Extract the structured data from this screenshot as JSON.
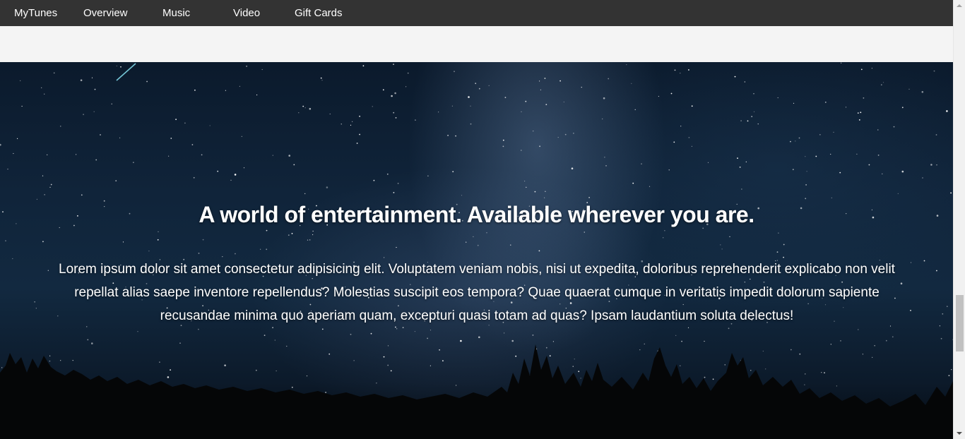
{
  "nav": {
    "brand": "MyTunes",
    "items": [
      {
        "label": "Overview"
      },
      {
        "label": "Music"
      },
      {
        "label": "Video"
      },
      {
        "label": "Gift Cards"
      }
    ]
  },
  "hero": {
    "title": "A world of entertainment. Available wherever you are.",
    "text": "Lorem ipsum dolor sit amet consectetur adipisicing elit. Voluptatem veniam nobis, nisi ut expedita, doloribus reprehenderit explicabo non velit repellat alias saepe inventore repellendus? Molestias suscipit eos tempora? Quae quaerat cumque in veritatis impedit dolorum sapiente recusandae minima quo aperiam quam, excepturi quasi totam ad quas? Ipsam laudantium soluta delectus!"
  },
  "scrollbar": {
    "scroll_position": 0.75
  },
  "colors": {
    "navbar": "#333333",
    "nav_text": "#ffffff",
    "band": "#f4f4f4",
    "sky": "#10243a"
  }
}
